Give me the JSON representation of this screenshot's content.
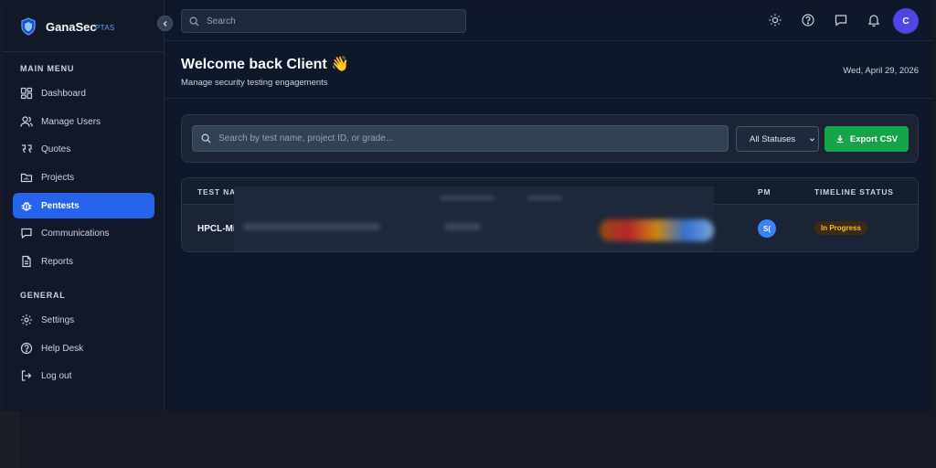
{
  "brand": {
    "name": "GanaSec",
    "sub": "PTAS"
  },
  "sidebar": {
    "main_title": "MAIN MENU",
    "main_items": [
      {
        "label": "Dashboard",
        "icon": "dashboard-icon"
      },
      {
        "label": "Manage Users",
        "icon": "users-icon"
      },
      {
        "label": "Quotes",
        "icon": "quote-icon"
      },
      {
        "label": "Projects",
        "icon": "folder-icon"
      },
      {
        "label": "Pentests",
        "icon": "bug-icon",
        "active": true
      },
      {
        "label": "Communications",
        "icon": "chat-icon"
      },
      {
        "label": "Reports",
        "icon": "document-icon"
      }
    ],
    "general_title": "GENERAL",
    "general_items": [
      {
        "label": "Settings",
        "icon": "gear-icon"
      },
      {
        "label": "Help Desk",
        "icon": "help-icon"
      },
      {
        "label": "Log out",
        "icon": "logout-icon"
      }
    ]
  },
  "topbar": {
    "search_placeholder": "Search",
    "avatar_initial": "C",
    "icons": [
      "sun-icon",
      "help-icon",
      "message-icon",
      "bell-icon"
    ]
  },
  "header": {
    "title": "Welcome back Client 👋",
    "subtitle": "Manage security testing engagements",
    "date": "Wed, April 29, 2026"
  },
  "filters": {
    "search_placeholder": "Search by test name, project ID, or grade...",
    "status_value": "All Statuses",
    "export_label": "Export CSV"
  },
  "table": {
    "columns": [
      "TEST NA",
      "PM",
      "TIMELINE STATUS"
    ],
    "rows": [
      {
        "name": "HPCL-Mi",
        "pm_initials": "S(",
        "status": "In Progress"
      }
    ]
  },
  "colors": {
    "accent": "#2563eb",
    "export": "#16a34a",
    "status_in_progress": "#fbbf24"
  }
}
